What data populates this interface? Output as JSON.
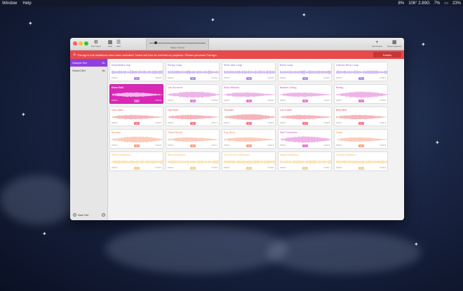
{
  "menubar": {
    "left_items": [
      "Window",
      "Help"
    ],
    "cpu": "8%",
    "network": "106° 2.89G",
    "memory": "7%",
    "battery": "23%"
  },
  "toolbar": {
    "tools_left": [
      {
        "icon": "tool-icon",
        "label": "Prior Sync"
      },
      {
        "icon": "grid-icon",
        "label": "View"
      },
      {
        "icon": "list-icon",
        "label": "Edit"
      }
    ],
    "volume_label": "Master Volume",
    "volume_level": 0.08,
    "tools_right": [
      {
        "icon": "plus-icon",
        "label": "Add Sound"
      },
      {
        "icon": "grid-icon",
        "label": "Show Inspector"
      }
    ]
  },
  "alert": {
    "message": "Farrago's trial limitations have been activated. Noise will now be overlaid on playback. Please purchase Farrago.",
    "button": "Details"
  },
  "sidebar": {
    "items": [
      {
        "label": "Sample Set",
        "shortcut": "⌘1",
        "active": true
      },
      {
        "label": "Sound Set",
        "shortcut": "⌘2",
        "active": false
      }
    ],
    "new_set": "New Set"
  },
  "tiles": [
    {
      "name": "Downbeat Loop",
      "start": "0:00.0",
      "end": "0:02.8",
      "key": "1",
      "color": "#b08ce8"
    },
    {
      "name": "Funky Loop",
      "start": "0:00.0",
      "end": "0:04.0",
      "key": "2",
      "color": "#b08ce8"
    },
    {
      "name": "Slow Jam Loop",
      "start": "0:00.0",
      "end": "0:04.8",
      "key": "3",
      "color": "#b08ce8"
    },
    {
      "name": "Rock Loop",
      "start": "0:00.0",
      "end": "0:04.0",
      "key": "4",
      "color": "#b08ce8"
    },
    {
      "name": "Classic Rock Loop",
      "start": "0:00.0",
      "end": "0:06.4",
      "key": "5",
      "color": "#b08ce8"
    },
    {
      "name": "Drum Roll",
      "start": "0:00.0",
      "end": "0:04.2",
      "key": "Q",
      "color": "#ffffff",
      "selected": true
    },
    {
      "name": "Car Screech",
      "start": "0:00.0",
      "end": "0:02.8",
      "key": "W",
      "color": "#e07ad6"
    },
    {
      "name": "Slide Whistle",
      "start": "0:00.0",
      "end": "0:02.0",
      "key": "E",
      "color": "#e07ad6"
    },
    {
      "name": "Badum-Ching",
      "start": "0:00.0",
      "end": "0:01.9",
      "key": "R",
      "color": "#e07ad6"
    },
    {
      "name": "Boing",
      "start": "0:00.0",
      "end": "0:00.8",
      "key": "T",
      "color": "#e07ad6"
    },
    {
      "name": "Car Lease",
      "start": "0:00.0",
      "end": "0:04.5",
      "key": "A",
      "color": "#f07a86"
    },
    {
      "name": "Car Horn",
      "start": "0:00.0",
      "end": "0:01.1",
      "key": "S",
      "color": "#f07a86"
    },
    {
      "name": "Thunder",
      "start": "0:00.0",
      "end": "0:06.5",
      "key": "D",
      "color": "#f07a86"
    },
    {
      "name": "Car Crash",
      "start": "0:00.0",
      "end": "0:03.8",
      "key": "F",
      "color": "#f07a86"
    },
    {
      "name": "Bike Bell",
      "start": "0:00.0",
      "end": "0:01.2",
      "key": "G",
      "color": "#f07a86"
    },
    {
      "name": "Scream",
      "start": "0:00.0",
      "end": "0:02.5",
      "key": "Z",
      "color": "#f6a487"
    },
    {
      "name": "Glass Break",
      "start": "0:00.0",
      "end": "0:01.1",
      "key": "X",
      "color": "#f6a487"
    },
    {
      "name": "Fog Horn",
      "start": "0:00.0",
      "end": "0:04.3",
      "key": "C",
      "color": "#f6a487"
    },
    {
      "name": "Sad Trombone",
      "start": "0:00.0",
      "end": "0:04.0",
      "key": "V",
      "color": "#e07ad6"
    },
    {
      "name": "Laser",
      "start": "0:00.0",
      "end": "0:00.5",
      "key": "B",
      "color": "#f6a487"
    },
    {
      "name": "Street Ambience",
      "start": "0:00.0",
      "end": "0:40.3",
      "key": "⇧1",
      "color": "#f5cf84"
    },
    {
      "name": "Rain Ambience",
      "start": "0:00.0",
      "end": "0:30.0",
      "key": "⇧2",
      "color": "#f5cf84"
    },
    {
      "name": "Car Interior Ambience",
      "start": "0:00.0",
      "end": "0:32.8",
      "key": "⇧3",
      "color": "#f5cf84"
    },
    {
      "name": "Night Ambience",
      "start": "0:00.0",
      "end": "0:26.2",
      "key": "⇧4",
      "color": "#f5cf84"
    },
    {
      "name": "Crowd Ambience",
      "start": "0:00.0",
      "end": "0:31.6",
      "key": "⇧5",
      "color": "#f5cf84"
    }
  ]
}
